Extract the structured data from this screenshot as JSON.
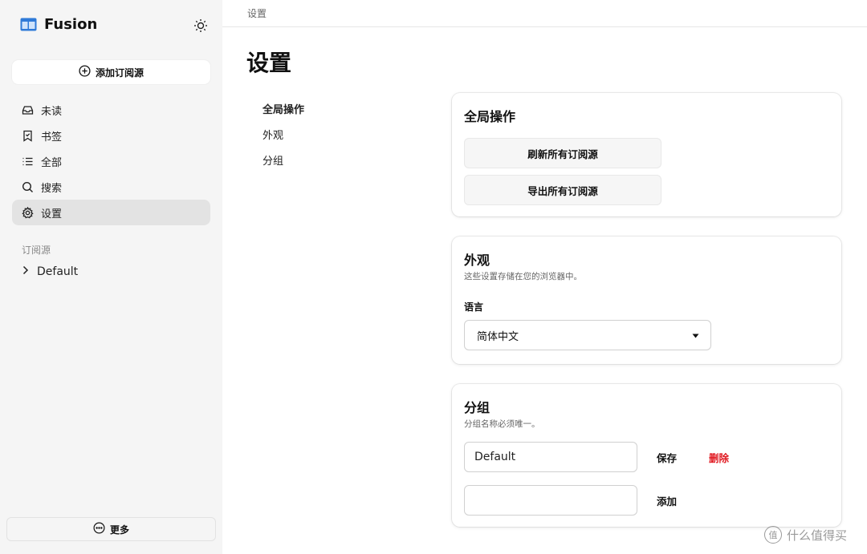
{
  "app": {
    "name": "Fusion"
  },
  "sidebar": {
    "add_feed_label": "添加订阅源",
    "nav": [
      {
        "label": "未读",
        "icon": "inbox-icon"
      },
      {
        "label": "书签",
        "icon": "bookmark-icon"
      },
      {
        "label": "全部",
        "icon": "list-icon"
      },
      {
        "label": "搜索",
        "icon": "search-icon"
      },
      {
        "label": "设置",
        "icon": "gear-icon",
        "active": true
      }
    ],
    "feeds_section_label": "订阅源",
    "groups": [
      {
        "label": "Default"
      }
    ],
    "more_label": "更多"
  },
  "header": {
    "breadcrumb": "设置"
  },
  "main": {
    "title": "设置",
    "subnav": [
      {
        "label": "全局操作",
        "active": true
      },
      {
        "label": "外观"
      },
      {
        "label": "分组"
      }
    ],
    "global_actions": {
      "title": "全局操作",
      "refresh_all_label": "刷新所有订阅源",
      "export_all_label": "导出所有订阅源"
    },
    "appearance": {
      "title": "外观",
      "description": "这些设置存储在您的浏览器中。",
      "language_label": "语言",
      "language_value": "简体中文"
    },
    "groups": {
      "title": "分组",
      "description": "分组名称必须唯一。",
      "existing_group_value": "Default",
      "save_label": "保存",
      "delete_label": "删除",
      "new_group_value": "",
      "add_label": "添加"
    }
  },
  "watermark": {
    "text": "什么值得买",
    "badge": "值"
  },
  "colors": {
    "danger": "#e0161e",
    "sidebar_bg": "#f5f5f5",
    "brand_blue": "#2f7ad8"
  }
}
